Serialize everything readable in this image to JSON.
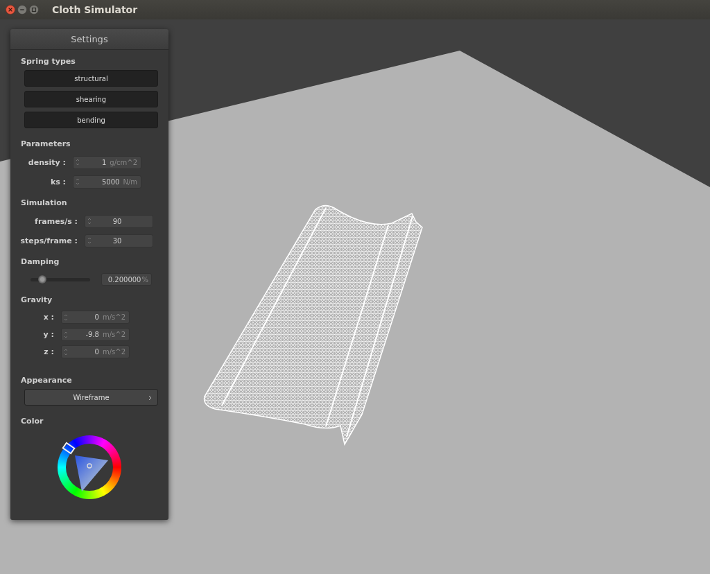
{
  "window": {
    "title": "Cloth Simulator"
  },
  "panel": {
    "title": "Settings"
  },
  "spring_types": {
    "heading": "Spring types",
    "buttons": [
      "structural",
      "shearing",
      "bending"
    ]
  },
  "parameters": {
    "heading": "Parameters",
    "fields": [
      {
        "label": "density :",
        "value": "1",
        "unit": "g/cm^2"
      },
      {
        "label": "ks :",
        "value": "5000",
        "unit": "N/m"
      }
    ]
  },
  "simulation": {
    "heading": "Simulation",
    "fields": [
      {
        "label": "frames/s :",
        "value": "90"
      },
      {
        "label": "steps/frame :",
        "value": "30"
      }
    ]
  },
  "damping": {
    "heading": "Damping",
    "level": 0.2,
    "value": "0.200000",
    "unit": "%"
  },
  "gravity": {
    "heading": "Gravity",
    "fields": [
      {
        "label": "x :",
        "value": "0",
        "unit": "m/s^2"
      },
      {
        "label": "y :",
        "value": "-9.8",
        "unit": "m/s^2"
      },
      {
        "label": "z :",
        "value": "0",
        "unit": "m/s^2"
      }
    ]
  },
  "appearance": {
    "heading": "Appearance",
    "value": "Wireframe"
  },
  "color": {
    "heading": "Color"
  }
}
